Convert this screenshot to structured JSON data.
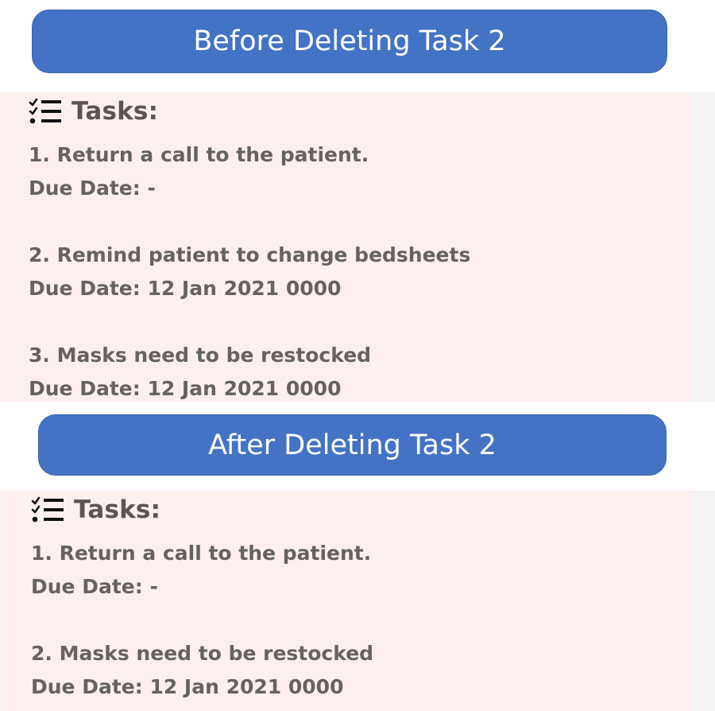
{
  "before": {
    "banner": "Before Deleting Task 2",
    "header": "Tasks:",
    "tasks": [
      {
        "title": "1. Return a call to the patient.",
        "due": "Due Date: -"
      },
      {
        "title": "2. Remind patient to change bedsheets",
        "due": "Due Date: 12 Jan 2021 0000"
      },
      {
        "title": "3. Masks need to be restocked",
        "due": "Due Date: 12 Jan 2021 0000"
      }
    ]
  },
  "after": {
    "banner": "After Deleting Task 2",
    "header": "Tasks:",
    "tasks": [
      {
        "title": "1. Return a call to the patient.",
        "due": "Due Date: -"
      },
      {
        "title": "2. Masks need to be restocked",
        "due": "Due Date: 12 Jan 2021 0000"
      }
    ]
  },
  "icons": {
    "task_list": "checklist-icon"
  },
  "colors": {
    "banner_bg": "#4472c4",
    "panel_bg": "#feefef",
    "text": "#666262"
  }
}
